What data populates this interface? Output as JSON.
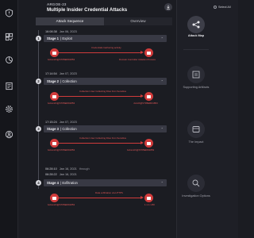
{
  "header": {
    "alert_id": "ARGOE-23",
    "title": "Multiple Insider Credential Attacks",
    "close_label": "×"
  },
  "tabs": [
    {
      "label": "Attack Sequence",
      "active": true
    },
    {
      "label": "Overview",
      "active": false
    }
  ],
  "stages": [
    {
      "number": "1",
      "timestamp": {
        "time": "16:08:38",
        "date": "Jan 06, 2023",
        "extra": ""
      },
      "title_prefix": "Stage 1",
      "title": "Exploit",
      "flow": {
        "source": "bobsmith@ST05ERD1853",
        "edge": "Credentials Gathering activity",
        "target": "Domain Controller initiation Process"
      }
    },
    {
      "number": "2",
      "timestamp": {
        "time": "17:14:54",
        "date": "Jan 07, 2023",
        "extra": ""
      },
      "title_prefix": "Stage 2",
      "title": "Collection",
      "flow": {
        "source": "bobsmith@ST05ERD1853",
        "edge": "Collection User Collecting Files from Sensitive",
        "target": "Jsmith@ST05ERD1853"
      }
    },
    {
      "number": "3",
      "timestamp": {
        "time": "17:15:24",
        "date": "Jan 07, 2023",
        "extra": ""
      },
      "title_prefix": "Stage 3",
      "title": "Collection",
      "flow": {
        "source": "bobsmith@ST05ERD1853",
        "edge": "Collection User Collecting Files from Sensitive",
        "target": "bobsmith@ST05ERD1853"
      }
    },
    {
      "number": "4",
      "timestamp": {
        "time": "06:28:10",
        "date": "Jan 16, 2021",
        "extra": "through"
      },
      "timestamp2": {
        "time": "06:28:22",
        "date": "Jan 16, 2021"
      },
      "title_prefix": "Stage 4",
      "title": "Exfiltration",
      "flow": {
        "source": "bobsmith@ST05ERD1853",
        "edge": "Data exfiltration via HTTPS",
        "target": "1.1.1.1:80"
      }
    }
  ],
  "right_panel": {
    "select_all": "Select All",
    "buttons": [
      {
        "label": "Attack Map",
        "icon": "attack-map-icon",
        "active": true
      },
      {
        "label": "Supporting Artifacts",
        "icon": "artifacts-icon",
        "active": false
      },
      {
        "label": "The Impact",
        "icon": "impact-icon",
        "active": false
      },
      {
        "label": "Investigation Options",
        "icon": "investigation-icon",
        "active": false
      }
    ]
  },
  "colors": {
    "background": "#1b1c22",
    "accent_red": "#d23c3c",
    "stage_bar": "#383944"
  }
}
